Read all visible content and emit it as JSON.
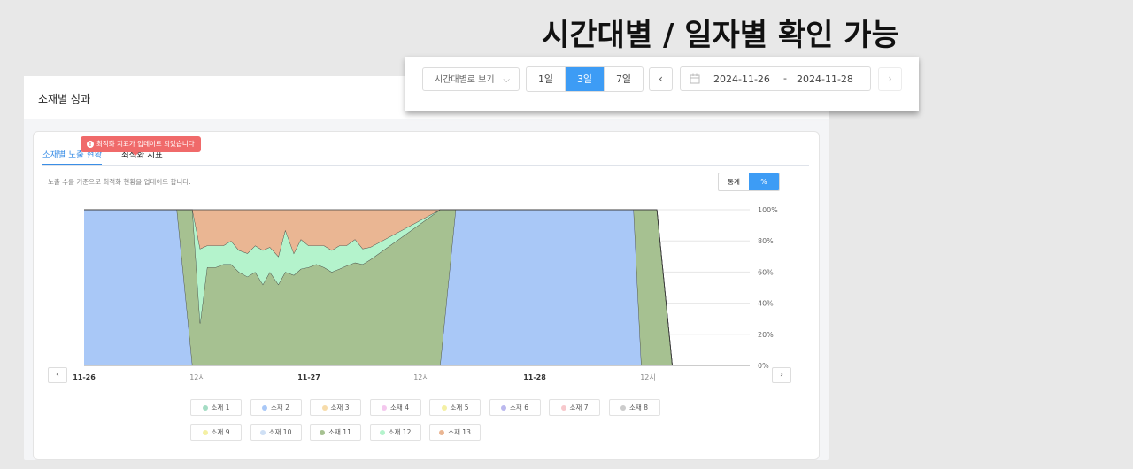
{
  "headline": "시간대별 / 일자별 확인 가능",
  "toolbar": {
    "view_select": "시간대별로 보기",
    "periods": [
      "1일",
      "3일",
      "7일"
    ],
    "active_period": "3일",
    "prev_icon": "chevron-left-icon",
    "next_icon": "chevron-right-icon",
    "calendar_icon": "calendar-icon",
    "date_start": "2024-11-26",
    "date_separator": "-",
    "date_end": "2024-11-28"
  },
  "panel": {
    "title": "소재별 성과",
    "tabs": [
      "소재별 노출 현황",
      "최적화 지표"
    ],
    "active_tab": "소재별 노출 현황",
    "tab_alert": "최적화 지표가 업데이트 되었습니다",
    "note": "노출 수를 기준으로 최적화 현황을 업데이트 합니다.",
    "toggle": [
      "통계",
      "%"
    ],
    "toggle_active": "%",
    "nav_prev": "‹",
    "nav_next": "›"
  },
  "chart_data": {
    "type": "area",
    "stacked": true,
    "normalized_percent": true,
    "x": [
      "11-26 02시",
      "11-26 06시",
      "11-26 10시",
      "11-26 12시",
      "11-26 13시",
      "11-26 14시",
      "11-26 15시",
      "11-26 16시",
      "11-26 17시",
      "11-26 18시",
      "11-26 19시",
      "11-26 20시",
      "11-26 21시",
      "11-26 22시",
      "11-26 23시",
      "11-27 00시",
      "11-27 01시",
      "11-27 02시",
      "11-27 03시",
      "11-27 04시",
      "11-27 05시",
      "11-27 06시",
      "11-27 07시",
      "11-27 08시",
      "11-27 09시",
      "11-27 10시",
      "11-27 11시",
      "11-27 12시",
      "11-27 13시",
      "11-27 18시",
      "11-28 08시",
      "11-28 09시",
      "11-28 10시",
      "11-28 11시",
      "11-28 12시",
      "11-28 13시",
      "11-28 16시"
    ],
    "x_tick_labels": [
      "11-26",
      "12시",
      "11-27",
      "12시",
      "11-28",
      "12시"
    ],
    "y_tick_labels": [
      "0%",
      "20%",
      "40%",
      "60%",
      "80%",
      "100%"
    ],
    "ylim": [
      0,
      100
    ],
    "grid": true,
    "series": [
      {
        "name": "소재 2",
        "color": "#a9c8f7",
        "values": [
          100,
          100,
          100,
          0,
          0,
          0,
          0,
          0,
          0,
          0,
          0,
          0,
          0,
          0,
          0,
          0,
          0,
          0,
          0,
          0,
          0,
          0,
          0,
          0,
          0,
          0,
          0,
          0,
          100,
          100,
          100,
          100,
          100,
          0,
          0,
          0,
          0
        ]
      },
      {
        "name": "소재 11",
        "color": "#a6c191",
        "values": [
          0,
          0,
          0,
          100,
          27,
          63,
          63,
          65,
          65,
          60,
          57,
          60,
          52,
          60,
          52,
          60,
          58,
          62,
          63,
          65,
          63,
          60,
          62,
          64,
          66,
          65,
          68,
          100,
          0,
          0,
          0,
          0,
          0,
          100,
          100,
          0,
          0
        ]
      },
      {
        "name": "소재 12",
        "color": "#b4f3cc",
        "values": [
          0,
          0,
          0,
          0,
          48,
          14,
          14,
          12,
          15,
          14,
          15,
          17,
          22,
          16,
          18,
          27,
          14,
          19,
          14,
          12,
          14,
          14,
          15,
          13,
          15,
          10,
          8,
          0,
          0,
          0,
          0,
          0,
          0,
          0,
          0,
          0,
          0
        ]
      },
      {
        "name": "소재 13",
        "color": "#eab693",
        "values": [
          0,
          0,
          0,
          0,
          25,
          23,
          23,
          23,
          20,
          26,
          28,
          23,
          26,
          24,
          30,
          13,
          28,
          19,
          23,
          23,
          23,
          26,
          23,
          23,
          19,
          25,
          24,
          0,
          0,
          0,
          0,
          0,
          0,
          0,
          0,
          0,
          0
        ]
      }
    ],
    "legend": [
      "소재 1",
      "소재 2",
      "소재 3",
      "소재 4",
      "소재 5",
      "소재 6",
      "소재 7",
      "소재 8",
      "소재 9",
      "소재 10",
      "소재 11",
      "소재 12",
      "소재 13"
    ],
    "legend_colors": [
      "#a4dcc4",
      "#a9c8f7",
      "#f7dcaa",
      "#f4c8ee",
      "#f4f0a4",
      "#bbb8ee",
      "#f7c8cc",
      "#cccccc",
      "#f4f0a4",
      "#cfe0f5",
      "#a6c191",
      "#b4f3cc",
      "#eab693"
    ]
  }
}
